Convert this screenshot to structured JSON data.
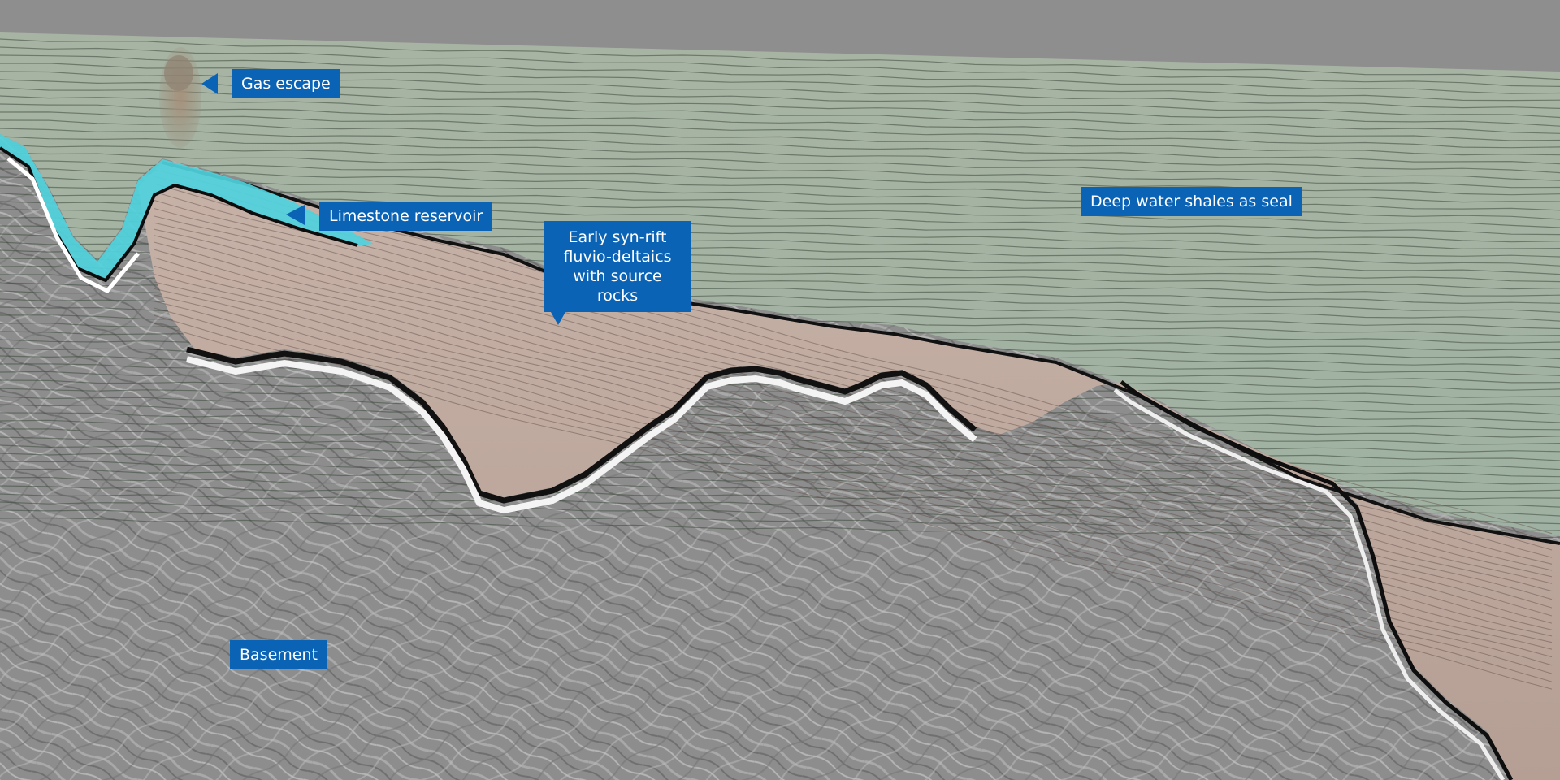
{
  "colors": {
    "background": "#8e8e8e",
    "callout": "#0a63b5",
    "callout_text": "#ffffff",
    "seal_tint": "#a7b5a2",
    "reservoir": "#4fd2dc",
    "synrift_tint": "#c2a99e",
    "basement": "#8c8c8c",
    "gas_plume": "#a08e78"
  },
  "labels": {
    "gas_escape": "Gas escape",
    "limestone_reservoir": "Limestone reservoir",
    "early_synrift": [
      "Early syn-rift",
      "fluvio-deltaics",
      "with source rocks"
    ],
    "deep_water_shales": "Deep water shales as seal",
    "basement": "Basement"
  }
}
